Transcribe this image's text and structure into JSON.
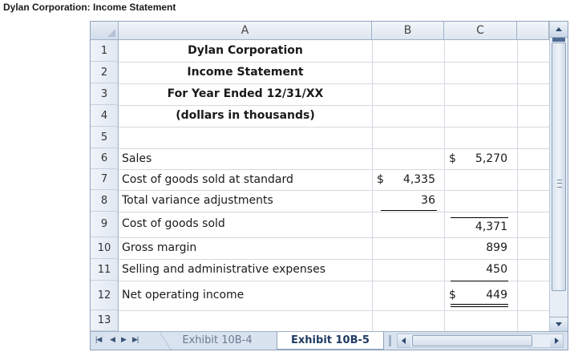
{
  "caption": "Dylan Corporation: Income Statement",
  "columns": [
    "A",
    "B",
    "C"
  ],
  "rows": [
    "1",
    "2",
    "3",
    "4",
    "5",
    "6",
    "7",
    "8",
    "9",
    "10",
    "11",
    "12",
    "13"
  ],
  "title_lines": [
    "Dylan Corporation",
    "Income Statement",
    "For Year Ended 12/31/XX",
    "(dollars in thousands)"
  ],
  "line_items": [
    {
      "row": "6",
      "label": "Sales",
      "col_b": "",
      "col_c_prefix": "$",
      "col_c": "5,270"
    },
    {
      "row": "7",
      "label": "Cost of goods sold at standard",
      "col_b_prefix": "$",
      "col_b": "4,335",
      "col_c": ""
    },
    {
      "row": "8",
      "label": "Total variance adjustments",
      "col_b": "36",
      "col_c": ""
    },
    {
      "row": "9",
      "label": "Cost of goods sold",
      "col_b": "",
      "col_c": "4,371"
    },
    {
      "row": "10",
      "label": "Gross margin",
      "col_b": "",
      "col_c": "899"
    },
    {
      "row": "11",
      "label": "Selling and administrative expenses",
      "col_b": "",
      "col_c": "450"
    },
    {
      "row": "12",
      "label": "Net operating income",
      "col_b": "",
      "col_c_prefix": "$",
      "col_c": "449"
    }
  ],
  "sheet_tabs": [
    {
      "label": "Exhibit 10B-4",
      "active": false
    },
    {
      "label": "Exhibit 10B-5",
      "active": true
    }
  ],
  "nav_buttons": [
    "first-sheet",
    "previous-sheet",
    "next-sheet",
    "last-sheet"
  ]
}
